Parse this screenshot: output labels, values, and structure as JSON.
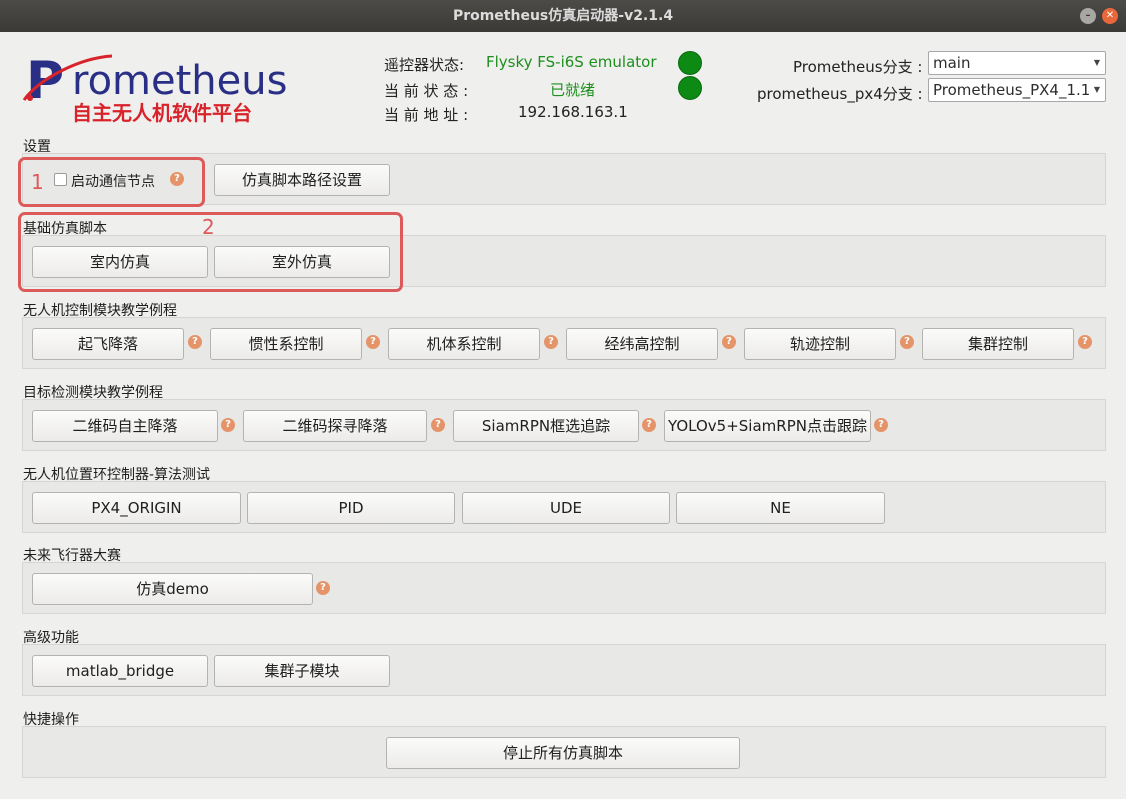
{
  "window": {
    "title": "Prometheus仿真启动器-v2.1.4"
  },
  "logo": {
    "main": "rometheus",
    "letter": "P",
    "sub": "自主无人机软件平台"
  },
  "status": {
    "remote_label": "遥控器状态:",
    "remote_value": "Flysky FS-i6S emulator",
    "current_state_label": "当 前 状 态 :",
    "current_state_value": "已就绪",
    "address_label": "当 前 地 址 :",
    "address_value": "192.168.163.1",
    "led_color": "#0c8a14"
  },
  "branches": {
    "prometheus_label": "Prometheus分支 :",
    "prometheus_value": "main",
    "px4_label": "prometheus_px4分支 :",
    "px4_value": "Prometheus_PX4_1.1"
  },
  "sections": {
    "settings": {
      "title": "设置",
      "checkbox_label": "启动通信节点",
      "path_button": "仿真脚本路径设置"
    },
    "basic": {
      "title": "基础仿真脚本",
      "buttons": [
        "室内仿真",
        "室外仿真"
      ]
    },
    "control": {
      "title": "无人机控制模块教学例程",
      "buttons": [
        "起飞降落",
        "惯性系控制",
        "机体系控制",
        "经纬高控制",
        "轨迹控制",
        "集群控制"
      ]
    },
    "detection": {
      "title": "目标检测模块教学例程",
      "buttons": [
        "二维码自主降落",
        "二维码探寻降落",
        "SiamRPN框选追踪",
        "YOLOv5+SiamRPN点击跟踪"
      ]
    },
    "position": {
      "title": "无人机位置环控制器-算法测试",
      "buttons": [
        "PX4_ORIGIN",
        "PID",
        "UDE",
        "NE"
      ]
    },
    "contest": {
      "title": "未来飞行器大赛",
      "buttons": [
        "仿真demo"
      ]
    },
    "advanced": {
      "title": "高级功能",
      "buttons": [
        "matlab_bridge",
        "集群子模块"
      ]
    },
    "quick": {
      "title": "快捷操作",
      "buttons": [
        "停止所有仿真脚本"
      ]
    }
  },
  "annotations": {
    "one": "1",
    "two": "2",
    "highlight_color": "#dd5a5a"
  },
  "help_symbol": "?"
}
